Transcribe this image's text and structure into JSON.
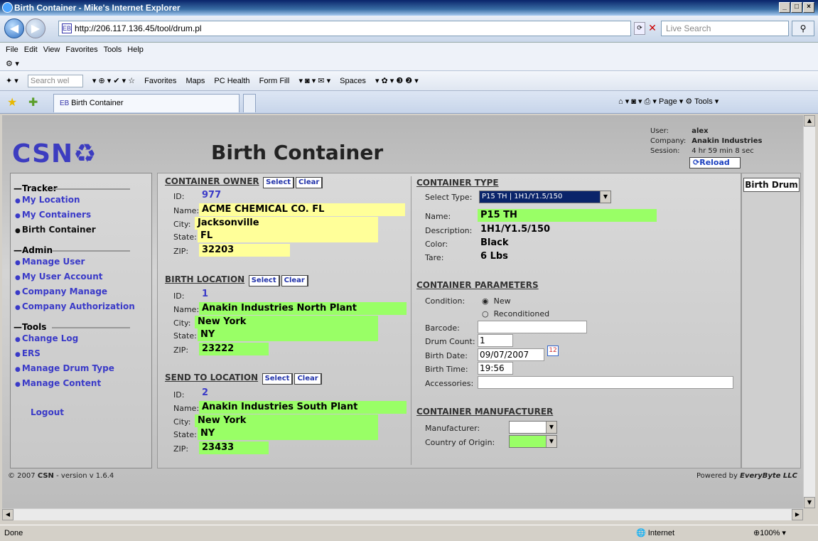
{
  "window": {
    "title": "Birth Container - Mike's Internet Explorer"
  },
  "address": {
    "url": "http://206.117.136.45/tool/drum.pl",
    "search_placeholder": "Live Search"
  },
  "menu": [
    "File",
    "Edit",
    "View",
    "Favorites",
    "Tools",
    "Help"
  ],
  "links_bar": {
    "search_placeholder": "Search wel",
    "items": [
      "Favorites",
      "Maps",
      "PC Health",
      "Form Fill",
      "Spaces"
    ]
  },
  "tabbar": {
    "tab_label": "Birth Container",
    "page_label": "Page",
    "tools_label": "Tools"
  },
  "header": {
    "logo": "CSN",
    "title": "Birth Container",
    "user_label": "User:",
    "user": "alex",
    "company_label": "Company:",
    "company": "Anakin Industries",
    "session_label": "Session:",
    "session": "4 hr 59 min 8 sec",
    "reload": "Reload"
  },
  "sidebar": {
    "tracker_title": "Tracker",
    "tracker": [
      "My Location",
      "My Containers",
      "Birth Container"
    ],
    "admin_title": "Admin",
    "admin": [
      "Manage User",
      "My User Account",
      "Company Manage",
      "Company Authorization"
    ],
    "tools_title": "Tools",
    "tools": [
      "Change Log",
      "ERS",
      "Manage Drum Type",
      "Manage Content"
    ],
    "logout": "Logout"
  },
  "buttons": {
    "select": "Select",
    "clear": "Clear"
  },
  "owner": {
    "title": "CONTAINER OWNER",
    "id_label": "ID:",
    "id": "977",
    "name_label": "Name:",
    "name": "ACME CHEMICAL CO. FL",
    "city_label": "City:",
    "city": "Jacksonville",
    "state_label": "State:",
    "state": "FL",
    "zip_label": "ZIP:",
    "zip": "32203"
  },
  "birth": {
    "title": "BIRTH LOCATION",
    "id_label": "ID:",
    "id": "1",
    "name_label": "Name:",
    "name": "Anakin Industries North Plant",
    "city_label": "City:",
    "city": "New York",
    "state_label": "State:",
    "state": "NY",
    "zip_label": "ZIP:",
    "zip": "23222"
  },
  "send": {
    "title": "SEND TO LOCATION",
    "id_label": "ID:",
    "id": "2",
    "name_label": "Name:",
    "name": "Anakin Industries South Plant",
    "city_label": "City:",
    "city": "New York",
    "state_label": "State:",
    "state": "NY",
    "zip_label": "ZIP:",
    "zip": "23433"
  },
  "ctype": {
    "title": "CONTAINER TYPE",
    "select_label": "Select Type:",
    "select_value": "P15 TH | 1H1/Y1.5/150",
    "name_label": "Name:",
    "name": "P15 TH",
    "desc_label": "Description:",
    "desc": "1H1/Y1.5/150",
    "color_label": "Color:",
    "color": "Black",
    "tare_label": "Tare:",
    "tare": "6 Lbs"
  },
  "params": {
    "title": "CONTAINER PARAMETERS",
    "condition_label": "Condition:",
    "opt_new": "New",
    "opt_recond": "Reconditioned",
    "barcode_label": "Barcode:",
    "barcode": "",
    "count_label": "Drum Count:",
    "count": "1",
    "date_label": "Birth Date:",
    "date": "09/07/2007",
    "time_label": "Birth Time:",
    "time": "19:56",
    "acc_label": "Accessories:",
    "acc": ""
  },
  "manuf": {
    "title": "CONTAINER MANUFACTURER",
    "manuf_label": "Manufacturer:",
    "origin_label": "Country of Origin:"
  },
  "right": {
    "button": "Birth Drum"
  },
  "footer": {
    "copyright": "© 2007",
    "brand": "CSN",
    "version": " - version v 1.6.4",
    "powered": "Powered by",
    "powered_brand": "EveryByte LLC"
  },
  "status": {
    "left": "Done",
    "zone": "Internet",
    "zoom": "100%"
  }
}
